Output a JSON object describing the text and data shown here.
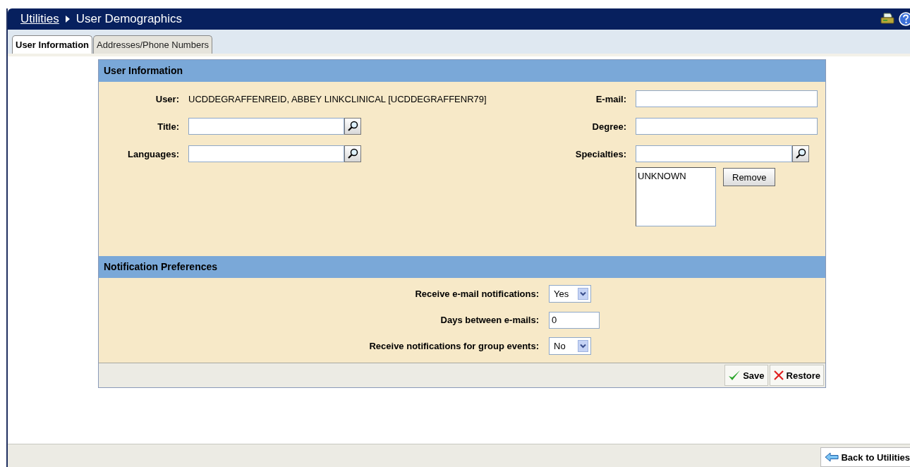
{
  "header": {
    "breadcrumb_link": "Utilities",
    "title": "User Demographics"
  },
  "tabs": [
    {
      "label": "User Information",
      "selected": true
    },
    {
      "label": "Addresses/Phone Numbers",
      "selected": false
    }
  ],
  "user_information": {
    "title": "User Information",
    "user_label": "User:",
    "user_value": "UCDDEGRAFFENREID, ABBEY LINKCLINICAL [UCDDEGRAFFENR79]",
    "left_fields": [
      {
        "label": "Title:",
        "kind": "lookup"
      },
      {
        "label": "Languages:",
        "kind": "lookup"
      }
    ],
    "right_fields": [
      {
        "label": "E-mail:",
        "kind": "text"
      },
      {
        "label": "Degree:",
        "kind": "text"
      },
      {
        "label": "Specialties:",
        "kind": "lookup"
      }
    ],
    "specialties_list": [
      "UNKNOWN"
    ],
    "remove_button": "Remove"
  },
  "notification_preferences": {
    "title": "Notification Preferences",
    "fields": [
      {
        "label": "Receive e-mail notifications:",
        "kind": "select",
        "value": "Yes"
      },
      {
        "label": "Days between e-mails:",
        "kind": "text",
        "value": "0"
      },
      {
        "label": "Receive notifications for group events:",
        "kind": "select",
        "value": "No"
      }
    ]
  },
  "actions": [
    {
      "label": "Save",
      "kind": "save"
    },
    {
      "label": "Restore",
      "kind": "restore"
    }
  ],
  "back_button": "Back to Utilities"
}
